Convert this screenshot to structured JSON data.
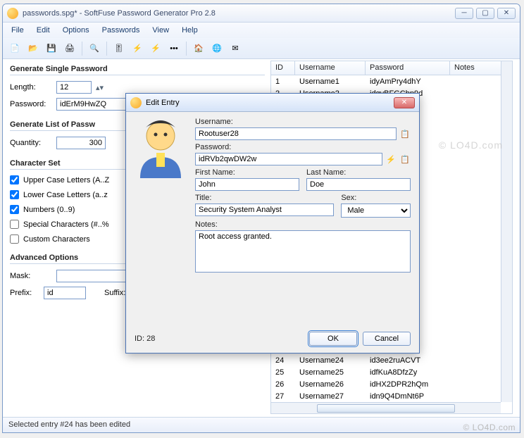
{
  "window": {
    "title": "passwords.spg* - SoftFuse Password Generator Pro 2.8"
  },
  "menu": [
    "File",
    "Edit",
    "Options",
    "Passwords",
    "View",
    "Help"
  ],
  "group_single": {
    "title": "Generate Single Password",
    "length_label": "Length:",
    "length_value": "12",
    "password_label": "Password:",
    "password_value": "idErM9HwZQ"
  },
  "group_list": {
    "title": "Generate List of Passw",
    "quantity_label": "Quantity:",
    "quantity_value": "300"
  },
  "charset": {
    "title": "Character Set",
    "opts": [
      {
        "label": "Upper Case Letters (A..Z",
        "checked": true
      },
      {
        "label": "Lower Case Letters (a..z",
        "checked": true
      },
      {
        "label": "Numbers (0..9)",
        "checked": true
      },
      {
        "label": "Special Characters (#..%",
        "checked": false
      },
      {
        "label": "Custom Characters",
        "checked": false
      }
    ]
  },
  "advanced": {
    "title": "Advanced Options",
    "mask_label": "Mask:",
    "mask_value": "",
    "prefix_label": "Prefix:",
    "prefix_value": "id",
    "suffix_label": "Suffix:",
    "suffix_value": ""
  },
  "table": {
    "headers": [
      "ID",
      "Username",
      "Password",
      "Notes"
    ],
    "rows_top": [
      {
        "id": "1",
        "user": "Username1",
        "pass": "idyAmPry4dhY"
      },
      {
        "id": "2",
        "user": "Username2",
        "pass": "idgyBFGCbp9d"
      }
    ],
    "rows_bottom": [
      {
        "id": "24",
        "user": "Username24",
        "pass": "id3ee2ruACVT"
      },
      {
        "id": "25",
        "user": "Username25",
        "pass": "idfKuA8DfzZy"
      },
      {
        "id": "26",
        "user": "Username26",
        "pass": "idHX2DPR2hQm"
      },
      {
        "id": "27",
        "user": "Username27",
        "pass": "idn9Q4DmNt6P"
      }
    ]
  },
  "statusbar": "Selected entry #24 has been edited",
  "dialog": {
    "title": "Edit Entry",
    "username_label": "Username:",
    "username_value": "Rootuser28",
    "password_label": "Password:",
    "password_value": "idRVb2qwDW2w",
    "firstname_label": "First Name:",
    "firstname_value": "John",
    "lastname_label": "Last Name:",
    "lastname_value": "Doe",
    "title_label": "Title:",
    "title_value": "Security System Analyst",
    "sex_label": "Sex:",
    "sex_value": "Male",
    "notes_label": "Notes:",
    "notes_value": "Root access granted.",
    "id_label": "ID:  28",
    "ok": "OK",
    "cancel": "Cancel"
  },
  "watermark": "© LO4D.com"
}
